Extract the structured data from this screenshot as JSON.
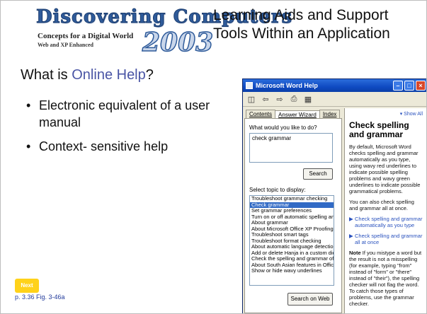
{
  "logo": {
    "title": "Discovering Computers",
    "subtitle": "Concepts for a Digital World",
    "subtitle2": "Web and XP Enhanced",
    "year": "2003"
  },
  "slide_title": "Learning Aids and Support Tools Within an Application",
  "heading": {
    "prefix": "What is ",
    "highlight": "Online Help",
    "suffix": "?"
  },
  "bullets": [
    "Electronic equivalent of a user manual",
    "Context- sensitive help"
  ],
  "bullet_glyph": "•",
  "next_label": "Next",
  "reference": "p. 3.36 Fig. 3-46a",
  "help_window": {
    "title": "Microsoft Word Help",
    "tabs": [
      "Contents",
      "Answer Wizard",
      "Index"
    ],
    "question_label": "What would you like to do?",
    "question_value": "check grammar",
    "search_label": "Search",
    "topic_label": "Select topic to display:",
    "topics": [
      "Troubleshoot grammar checking",
      "Check grammar",
      "Set grammar preferences",
      "Turn on or off automatic spelling and",
      "About grammar",
      "About Microsoft Office XP Proofing To",
      "Troubleshoot smart tags",
      "Troubleshoot format checking",
      "About automatic language detection",
      "Add or delete Hanja in a custom dictio",
      "Check the spelling and grammar of te",
      "About South Asian features in Office",
      "Show or hide wavy underlines"
    ],
    "selected_topic_index": 1,
    "search_web_label": "Search on Web",
    "show_all": "▾ Show All",
    "content_title": "Check spelling and grammar",
    "paragraph1": "By default, Microsoft Word checks spelling and grammar automatically as you type, using wavy red underlines to indicate possible spelling problems and wavy green underlines to indicate possible grammatical problems.",
    "paragraph2": "You can also check spelling and grammar all at once.",
    "links": [
      "Check spelling and grammar automatically as you type",
      "Check spelling and grammar all at once"
    ],
    "note_label": "Note",
    "note_text": " If you mistype a word but the result is not a misspelling (for example, typing \"from\" instead of \"form\" or \"there\" instead of \"their\"), the spelling checker will not flag the word. To catch those types of problems, use the grammar checker."
  },
  "colors": {
    "highlight": "#4a55a5",
    "next_badge": "#ffd21a",
    "titlebar": "#0f4ac2",
    "selection": "#316ac5"
  }
}
